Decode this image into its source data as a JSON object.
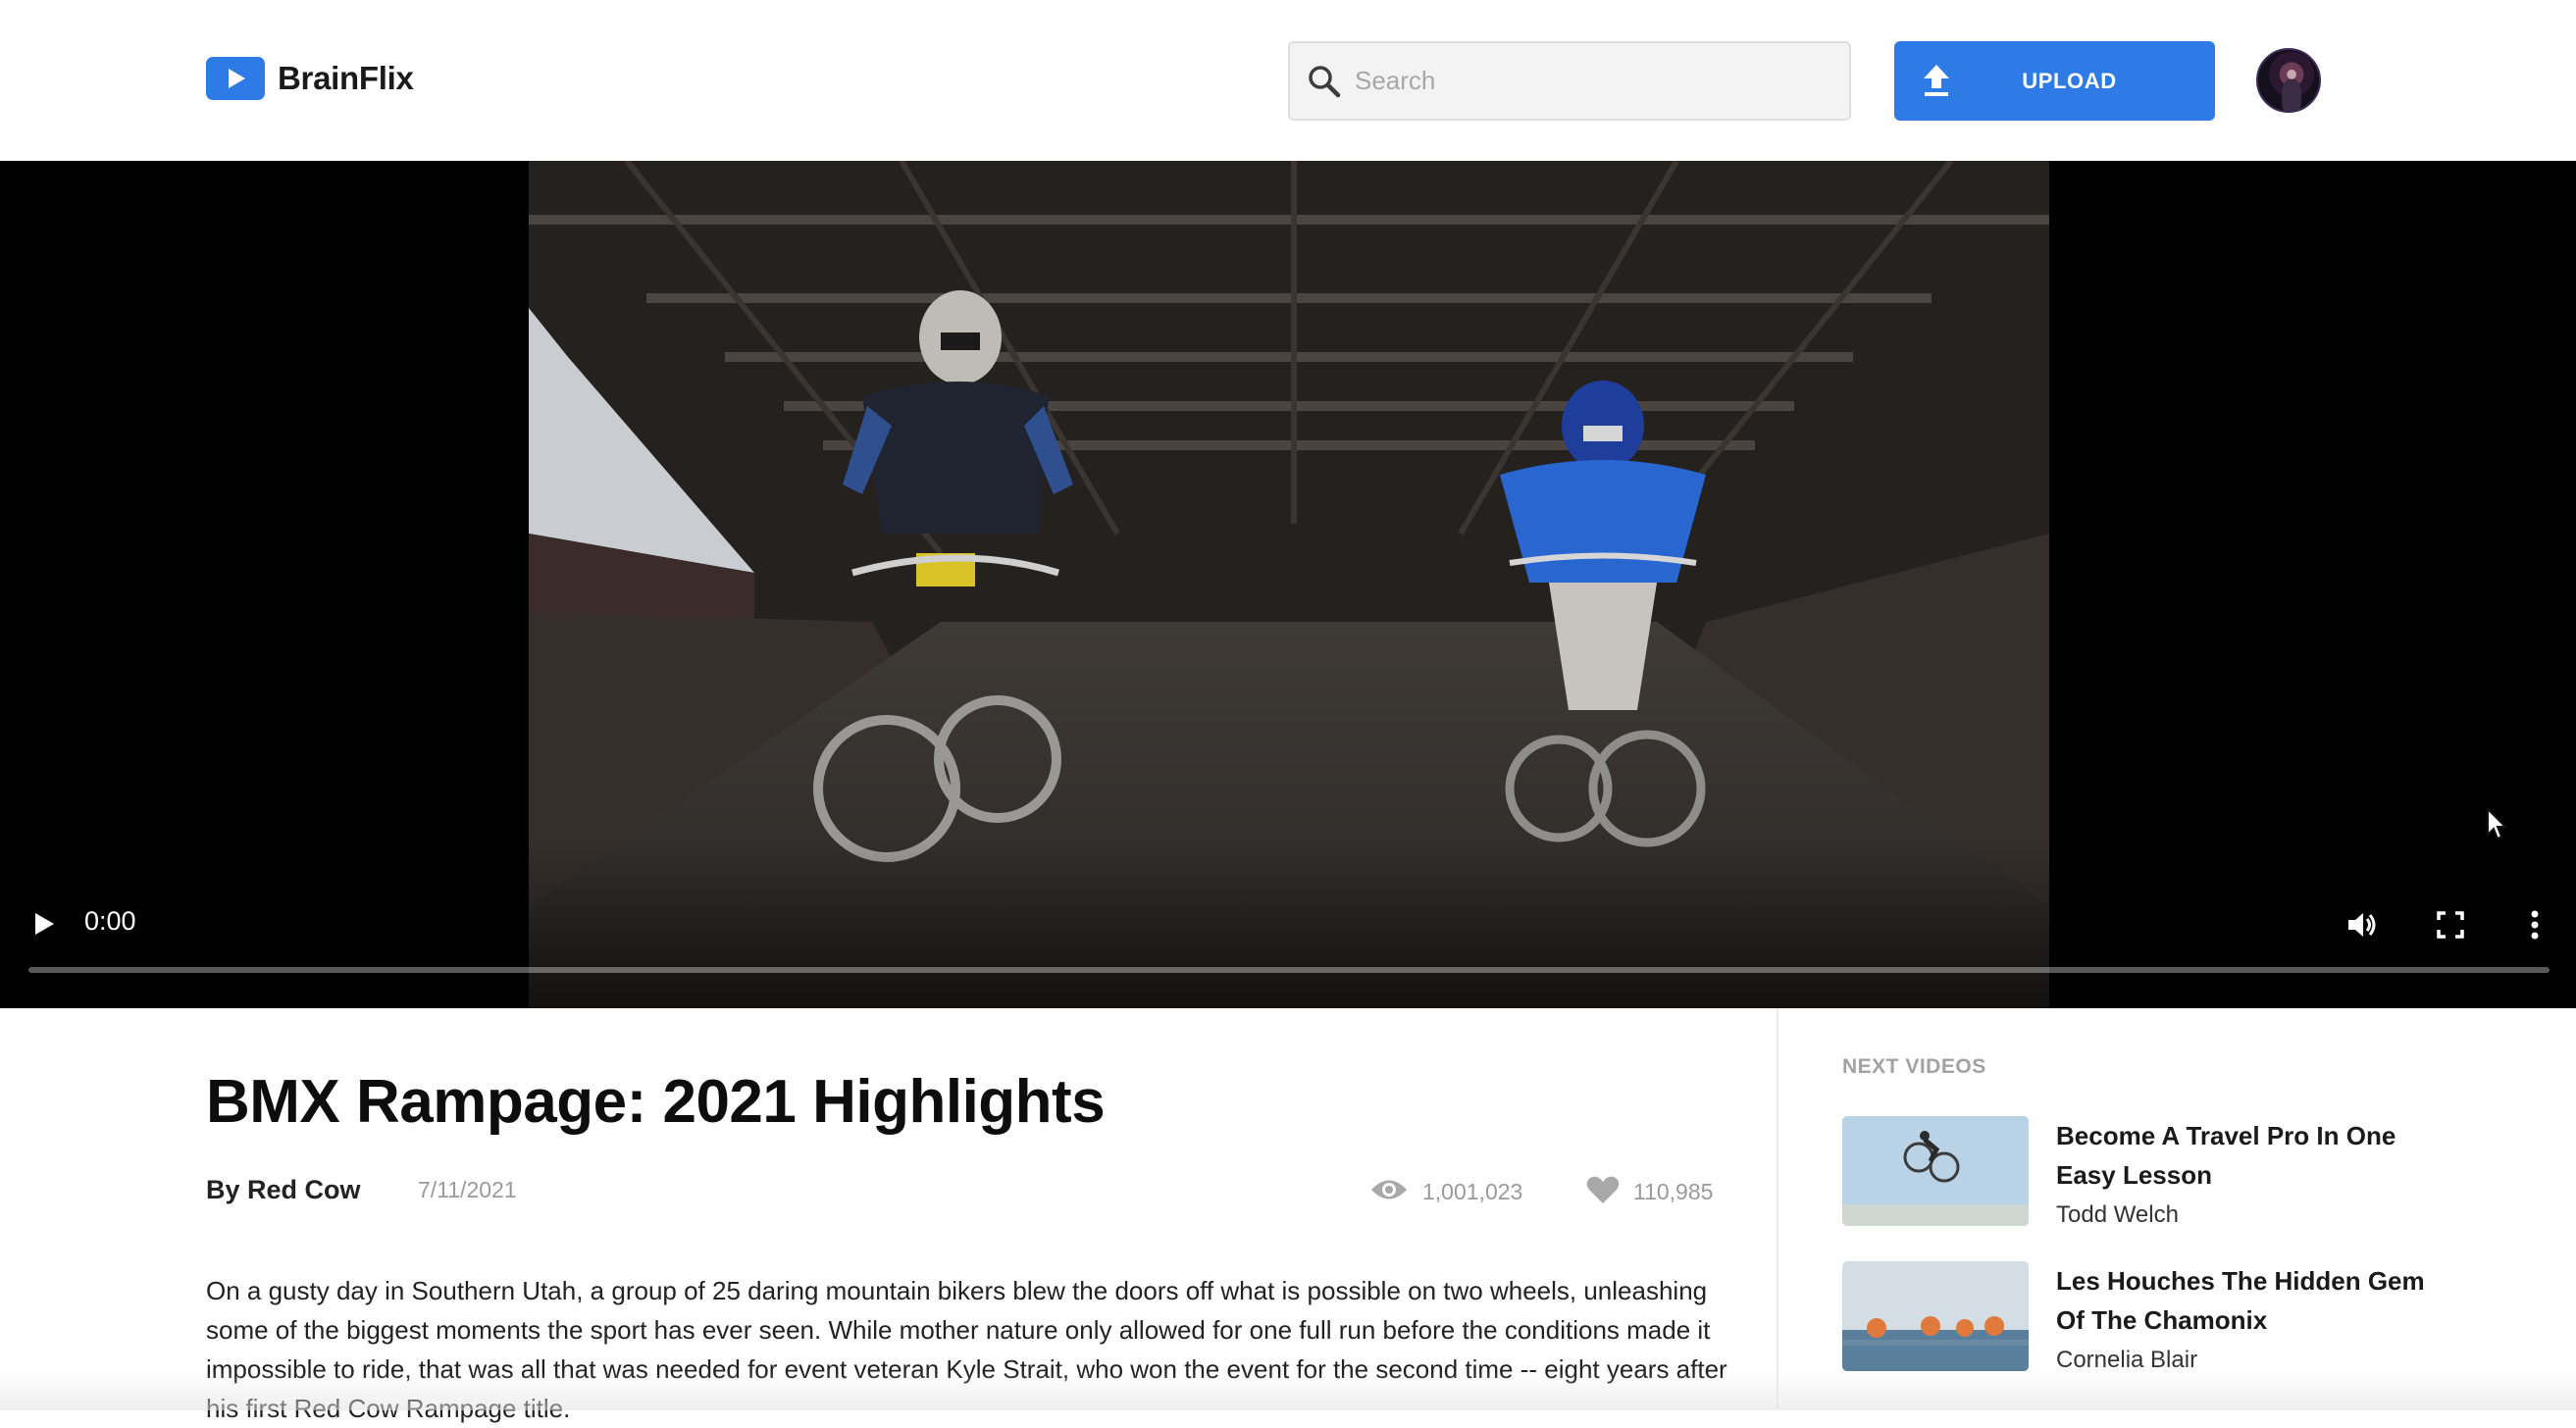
{
  "header": {
    "logo_text": "BrainFlix",
    "logo_icon": "play-icon",
    "search_placeholder": "Search",
    "upload_label": "UPLOAD",
    "brand_color": "#2e7be8"
  },
  "player": {
    "time": "0:00",
    "progress": 0,
    "controls": [
      "play-icon",
      "volume-icon",
      "fullscreen-icon",
      "more-vertical-icon"
    ]
  },
  "video": {
    "title": "BMX Rampage: 2021 Highlights",
    "author": "By Red Cow",
    "date": "7/11/2021",
    "views": "1,001,023",
    "likes": "110,985",
    "description": "On a gusty day in Southern Utah, a group of 25 daring mountain bikers blew the doors off what is possible on two wheels, unleashing some of the biggest moments the sport has ever seen. While mother nature only allowed for one full run before the conditions made it impossible to ride, that was all that was needed for event veteran Kyle Strait, who won the event for the second time -- eight years after his first Red Cow Rampage title."
  },
  "next_videos": {
    "heading": "NEXT VIDEOS",
    "items": [
      {
        "title": "Become A Travel Pro In One Easy Lesson",
        "author": "Todd Welch"
      },
      {
        "title": "Les Houches The Hidden Gem Of The Chamonix",
        "author": "Cornelia Blair"
      }
    ]
  }
}
